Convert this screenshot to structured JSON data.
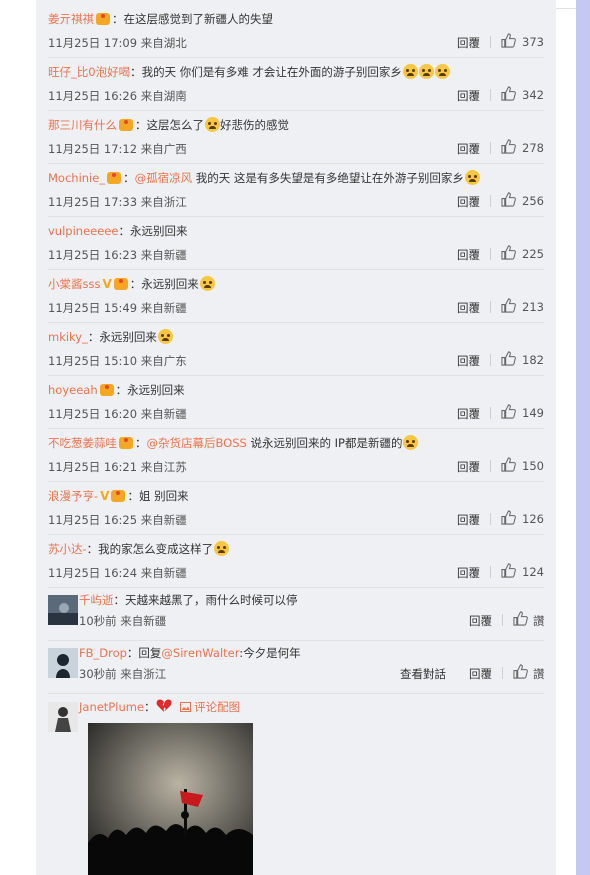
{
  "comments": [
    {
      "user": "姜亓祺祺",
      "text": "：在这层感觉到了新疆人的失望",
      "time": "11月25日 17:09 来自湖北",
      "reply": "回覆",
      "likes": "373"
    },
    {
      "user": "旺仔_比0泡好喝",
      "text": "：我的天 你们是有多难 才会让在外面的游子别回家乡",
      "time": "11月25日 16:26 来自湖南",
      "reply": "回覆",
      "likes": "342"
    },
    {
      "user": "那三川有什么",
      "text": "：这层怎么了",
      "text2": "好悲伤的感觉",
      "time": "11月25日 17:12 来自广西",
      "reply": "回覆",
      "likes": "278"
    },
    {
      "user": "Mochinie_",
      "at": "@孤宿凉风",
      "text": " 我的天 这是有多失望是有多绝望让在外游子别回家乡",
      "time": "11月25日 17:33 来自浙江",
      "reply": "回覆",
      "likes": "256"
    },
    {
      "user": "vulpineeeee",
      "text": "：永远别回来",
      "time": "11月25日 16:23 来自新疆",
      "reply": "回覆",
      "likes": "225"
    },
    {
      "user": "小棠酱sss",
      "text": "：永远别回来",
      "time": "11月25日 15:49 来自新疆",
      "reply": "回覆",
      "likes": "213"
    },
    {
      "user": "mkiky_",
      "text": "：永远别回来",
      "time": "11月25日 15:10 来自广东",
      "reply": "回覆",
      "likes": "182"
    },
    {
      "user": "hoyeeah",
      "text": "：永远别回来",
      "time": "11月25日 16:20 来自新疆",
      "reply": "回覆",
      "likes": "149"
    },
    {
      "user": "不吃葱姜蒜哇",
      "at": "@杂货店幕后BOSS",
      "text": " 说永远别回来的 IP都是新疆的",
      "time": "11月25日 16:21 来自江苏",
      "reply": "回覆",
      "likes": "150"
    },
    {
      "user": "浪漫予亨-",
      "text": "：姐 别回来",
      "time": "11月25日 16:25 来自新疆",
      "reply": "回覆",
      "likes": "126"
    },
    {
      "user": "苏小达-",
      "text": "：我的家怎么变成这样了",
      "time": "11月25日 16:24 来自新疆",
      "reply": "回覆",
      "likes": "124"
    }
  ],
  "avatar_comments": [
    {
      "user": "千屿逝",
      "text": "：天越来越黑了，雨什么时候可以停",
      "time": "10秒前 来自新疆",
      "reply": "回覆",
      "likes": "讚"
    },
    {
      "user": "FB_Drop",
      "prefix": "：回复",
      "at": "@SirenWalter",
      "text": ":今夕是何年",
      "time": "30秒前 来自浙江",
      "view": "查看對話",
      "reply": "回覆",
      "likes": "讚"
    }
  ],
  "last": {
    "user": "JanetPlume",
    "sep": "：",
    "pic_label": "评论配图"
  },
  "colors": {
    "username": "#eb7350",
    "panel": "#eff0f3",
    "scrollbar": "#c5c8f0"
  }
}
